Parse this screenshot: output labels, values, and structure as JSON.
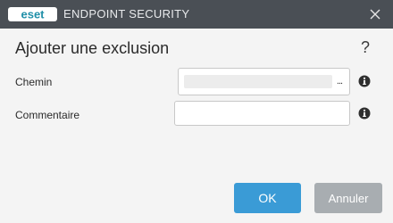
{
  "titlebar": {
    "logo_text": "eset",
    "product": "ENDPOINT SECURITY",
    "close_icon": "close-icon"
  },
  "dialog": {
    "title": "Ajouter une exclusion",
    "help_label": "?"
  },
  "fields": {
    "path_label": "Chemin",
    "path_value": "",
    "browse_label": "...",
    "comment_label": "Commentaire",
    "comment_value": ""
  },
  "buttons": {
    "ok": "OK",
    "cancel": "Annuler"
  },
  "colors": {
    "titlebar": "#4a4f55",
    "ok_button": "#3a9bd6",
    "cancel_button": "#a8adb1",
    "eset_accent": "#1f8fa8"
  }
}
